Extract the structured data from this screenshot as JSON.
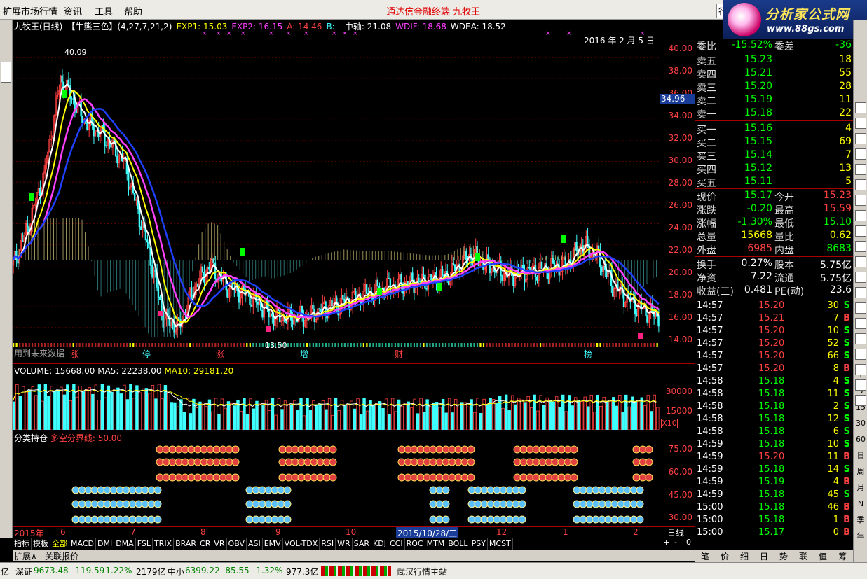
{
  "menu": {
    "items": [
      "扩展市场行情",
      "资讯",
      "工具",
      "帮助"
    ],
    "center_title": "通达信金融终端",
    "center_title2": "九牧王",
    "right_btn": "行"
  },
  "logo": {
    "line1": "分析家公式网",
    "line2": "www.88gs.com"
  },
  "chart": {
    "title": "九牧王(日线)",
    "formula": "【牛熊三色】(4,27,7,21,2)",
    "exp1": "EXP1: 15.03",
    "exp2": "EXP2: 16.15",
    "a": "A: 14.46",
    "b": "B: -",
    "mid": "中轴: 21.08",
    "wdif": "WDIF: 18.68",
    "wdea": "WDEA: 18.52",
    "date": "2016 年 2 月 5 日",
    "future_note": "用到未来数据",
    "high_label": "40.09",
    "low_label": "13.50",
    "current_price": "34.96",
    "signals": [
      "涨",
      "停",
      "涨",
      "增",
      "财",
      "榜"
    ],
    "y_ticks": [
      "40.00",
      "38.00",
      "36.00",
      "34.00",
      "32.00",
      "30.00",
      "28.00",
      "26.00",
      "24.00",
      "22.00",
      "20.00",
      "18.00",
      "16.00",
      "14.00"
    ]
  },
  "volume": {
    "title": "VOLUME: 15668.00",
    "ma5": "MA5: 22238.00",
    "ma10": "MA10: 29181.20",
    "y_ticks": [
      "30000",
      "15000"
    ],
    "unit": "X10"
  },
  "indicator": {
    "title": "分类持仓",
    "line": "多空分界线: 50.00",
    "y_ticks": [
      "75.00",
      "60.00",
      "45.00",
      "30.00"
    ]
  },
  "xaxis": {
    "labels": [
      "2015年",
      "6",
      "7",
      "8",
      "9",
      "10",
      "11",
      "12",
      "1",
      "2"
    ],
    "highlight": "2015/10/28/三",
    "period": "日线"
  },
  "tabs": [
    "指标",
    "模板",
    "全部",
    "MACD",
    "DMI",
    "DMA",
    "FSL",
    "TRIX",
    "BRAR",
    "CR",
    "VR",
    "OBV",
    "ASI",
    "EMV",
    "VOL-TDX",
    "RSI",
    "WR",
    "SAR",
    "KDJ",
    "CCI",
    "ROC",
    "MTM",
    "BOLL",
    "PSY",
    "MCST"
  ],
  "tab_controls": [
    "+",
    "-",
    "0"
  ],
  "bottom_tabs": [
    "扩展∧",
    "关联报价"
  ],
  "status": {
    "sz_label": "深证",
    "sz_value": "9673.48",
    "sz_change": "-119.59",
    "sz_pct": "-1.22%",
    "sz_amount": "2179亿",
    "zx_label": "中小",
    "zx_value": "6399.22",
    "zx_change": "-85.55",
    "zx_pct": "-1.32%",
    "zx_amount": "977.3亿",
    "left_unit": "亿",
    "site": "武汉行情主站"
  },
  "quote": {
    "weibi": {
      "label": "委比",
      "value": "-15.52%",
      "label2": "委差",
      "value2": "-36"
    },
    "sells": [
      {
        "label": "卖五",
        "price": "15.23",
        "vol": "18"
      },
      {
        "label": "卖四",
        "price": "15.21",
        "vol": "55"
      },
      {
        "label": "卖三",
        "price": "15.20",
        "vol": "28"
      },
      {
        "label": "卖二",
        "price": "15.19",
        "vol": "11"
      },
      {
        "label": "卖一",
        "price": "15.18",
        "vol": "22"
      }
    ],
    "buys": [
      {
        "label": "买一",
        "price": "15.16",
        "vol": "4"
      },
      {
        "label": "买二",
        "price": "15.15",
        "vol": "69"
      },
      {
        "label": "买三",
        "price": "15.14",
        "vol": "7"
      },
      {
        "label": "买四",
        "price": "15.12",
        "vol": "13"
      },
      {
        "label": "买五",
        "price": "15.11",
        "vol": "5"
      }
    ],
    "stats": [
      {
        "l1": "现价",
        "v1": "15.17",
        "l2": "今开",
        "v2": "15.23"
      },
      {
        "l1": "涨跌",
        "v1": "-0.20",
        "l2": "最高",
        "v2": "15.59"
      },
      {
        "l1": "涨幅",
        "v1": "-1.30%",
        "l2": "最低",
        "v2": "15.10"
      },
      {
        "l1": "总量",
        "v1": "15668",
        "l2": "量比",
        "v2": "0.62"
      },
      {
        "l1": "外盘",
        "v1": "6985",
        "l2": "内盘",
        "v2": "8683"
      }
    ],
    "stats2": [
      {
        "l1": "换手",
        "v1": "0.27%",
        "l2": "股本",
        "v2": "5.75亿"
      },
      {
        "l1": "净资",
        "v1": "7.22",
        "l2": "流通",
        "v2": "5.75亿"
      },
      {
        "l1": "收益(三)",
        "v1": "0.481",
        "l2": "PE(动)",
        "v2": "23.6"
      }
    ],
    "ticks": [
      {
        "t": "14:57",
        "p": "15.20",
        "v": "30",
        "s": "S"
      },
      {
        "t": "14:57",
        "p": "15.21",
        "v": "7",
        "s": "B"
      },
      {
        "t": "14:57",
        "p": "15.20",
        "v": "10",
        "s": "S"
      },
      {
        "t": "14:57",
        "p": "15.20",
        "v": "52",
        "s": "S"
      },
      {
        "t": "14:57",
        "p": "15.20",
        "v": "66",
        "s": "S"
      },
      {
        "t": "14:57",
        "p": "15.20",
        "v": "8",
        "s": "B"
      },
      {
        "t": "14:58",
        "p": "15.18",
        "v": "4",
        "s": "S"
      },
      {
        "t": "14:58",
        "p": "15.18",
        "v": "11",
        "s": "S"
      },
      {
        "t": "14:58",
        "p": "15.18",
        "v": "2",
        "s": "S"
      },
      {
        "t": "14:58",
        "p": "15.18",
        "v": "12",
        "s": "S"
      },
      {
        "t": "14:58",
        "p": "15.18",
        "v": "6",
        "s": "S"
      },
      {
        "t": "14:59",
        "p": "15.18",
        "v": "10",
        "s": "S"
      },
      {
        "t": "14:59",
        "p": "15.20",
        "v": "11",
        "s": "B"
      },
      {
        "t": "14:59",
        "p": "15.18",
        "v": "14",
        "s": "S"
      },
      {
        "t": "14:59",
        "p": "15.19",
        "v": "4",
        "s": "B"
      },
      {
        "t": "14:59",
        "p": "15.18",
        "v": "45",
        "s": "S"
      },
      {
        "t": "15:00",
        "p": "15.18",
        "v": "46",
        "s": "B"
      },
      {
        "t": "15:00",
        "p": "15.18",
        "v": "1",
        "s": "B"
      },
      {
        "t": "15:00",
        "p": "15.17",
        "v": "0",
        "s": "B"
      }
    ],
    "tabs": [
      "笔",
      "价",
      "细",
      "日",
      "势",
      "联",
      "值",
      "筹"
    ]
  },
  "sidebar_right": [
    "1",
    "5",
    "15",
    "30",
    "60",
    "日",
    "周",
    "月",
    "N",
    "季",
    "年"
  ],
  "colors": {
    "up": "#ff4040",
    "down": "#40ffff",
    "yellow": "#ffff00",
    "green": "#00ff00",
    "magenta": "#ff40ff",
    "blue": "#2040ff"
  }
}
